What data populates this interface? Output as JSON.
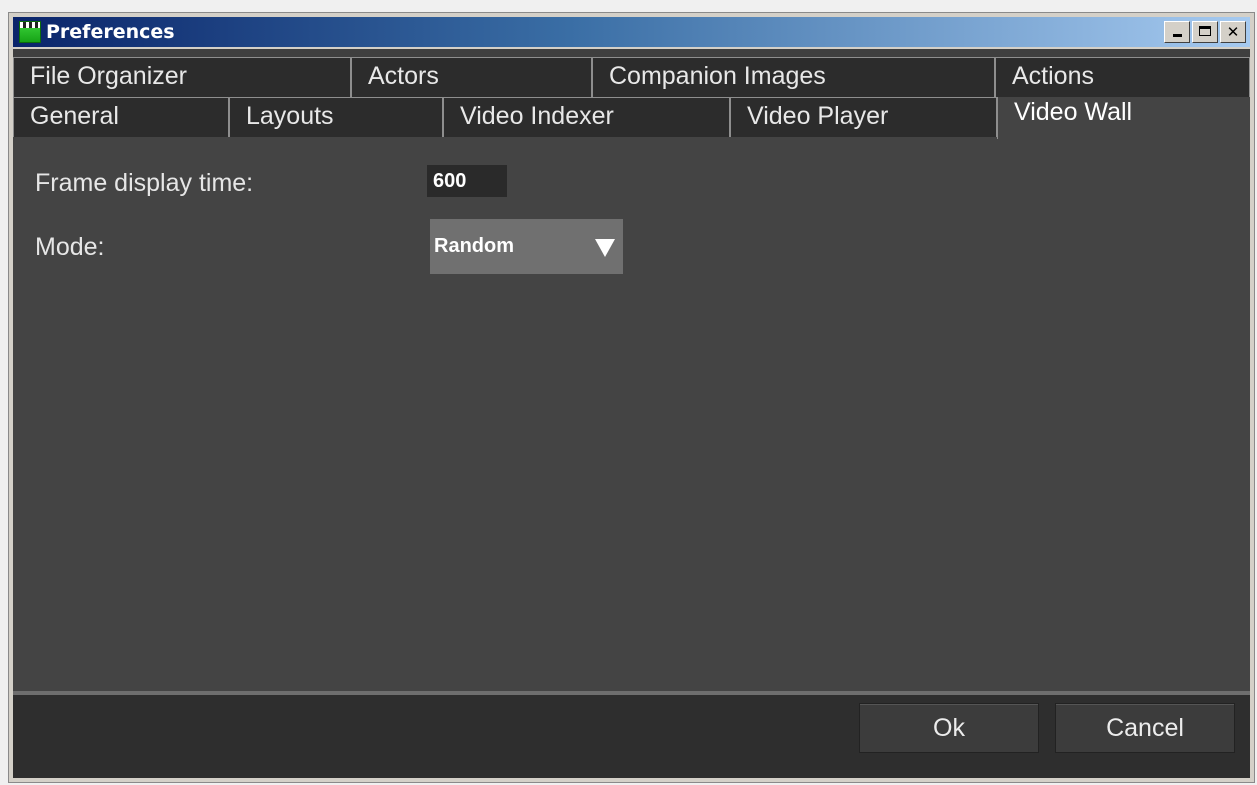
{
  "window": {
    "title": "Preferences",
    "controls": {
      "minimize_icon": "minimize-icon",
      "maximize_icon": "maximize-icon",
      "close_label": "✕"
    }
  },
  "tabs": {
    "row_top": [
      {
        "label": "File Organizer"
      },
      {
        "label": "Actors"
      },
      {
        "label": "Companion Images"
      },
      {
        "label": "Actions"
      }
    ],
    "row_bottom": [
      {
        "label": "General"
      },
      {
        "label": "Layouts"
      },
      {
        "label": "Video Indexer"
      },
      {
        "label": "Video Player"
      },
      {
        "label": "Video Wall"
      }
    ],
    "active": "Video Wall"
  },
  "settings": {
    "frame_display_time": {
      "label": "Frame display time:",
      "value": "600"
    },
    "mode": {
      "label": "Mode:",
      "value": "Random"
    }
  },
  "footer": {
    "ok_label": "Ok",
    "cancel_label": "Cancel"
  },
  "colors": {
    "background": "#444444",
    "tab_inactive": "#2c2c2c",
    "footer": "#2e2e2e",
    "titlebar_start": "#0a246a",
    "titlebar_end": "#a6caf0"
  }
}
